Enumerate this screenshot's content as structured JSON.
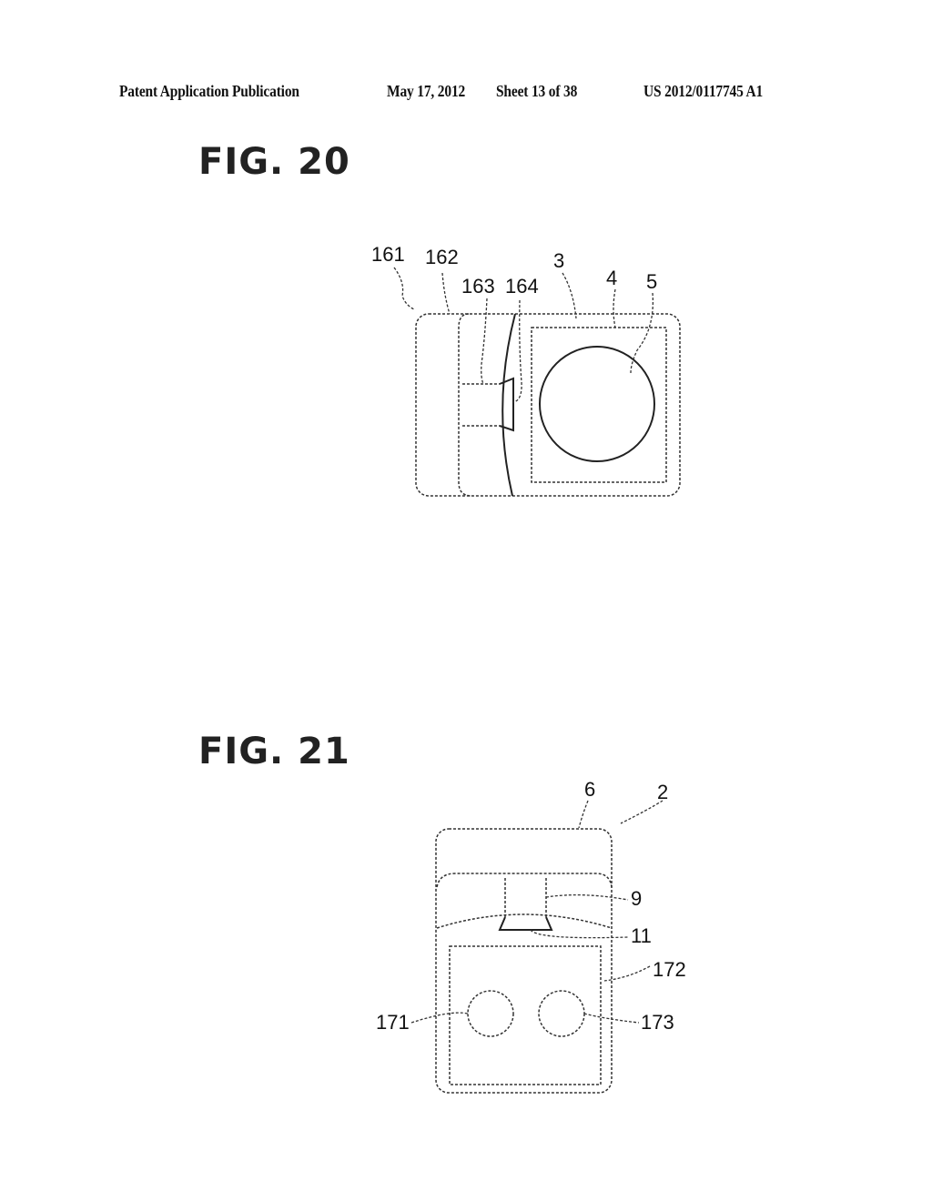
{
  "header": {
    "publication": "Patent Application Publication",
    "date": "May 17, 2012",
    "sheet": "Sheet 13 of 38",
    "number": "US 2012/0117745 A1"
  },
  "figures": [
    {
      "title": "FIG. 20",
      "labels": {
        "l161": "161",
        "l162": "162",
        "l163": "163",
        "l164": "164",
        "l3": "3",
        "l4": "4",
        "l5": "5"
      }
    },
    {
      "title": "FIG. 21",
      "labels": {
        "l6": "6",
        "l2": "2",
        "l9": "9",
        "l11": "11",
        "l172": "172",
        "l171": "171",
        "l173": "173"
      }
    }
  ]
}
